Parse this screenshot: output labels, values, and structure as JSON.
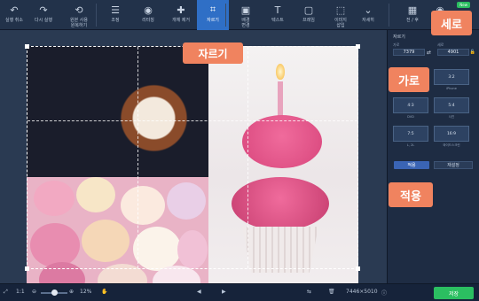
{
  "toolbar": {
    "tools": [
      {
        "id": "undo",
        "icon": "↶",
        "label": "실행 취소"
      },
      {
        "id": "redo",
        "icon": "↷",
        "label": "다시 실행"
      },
      {
        "id": "restore",
        "icon": "⟲",
        "label": "원본 사용\n원복하기"
      },
      {
        "id": "adjust",
        "icon": "☰",
        "label": "조정"
      },
      {
        "id": "retouch",
        "icon": "◉",
        "label": "리터칭"
      },
      {
        "id": "remove-object",
        "icon": "✚",
        "label": "개체 제거"
      },
      {
        "id": "crop",
        "icon": "⌗",
        "label": "자르기"
      },
      {
        "id": "background",
        "icon": "▣",
        "label": "배경\n변경"
      },
      {
        "id": "text",
        "icon": "T",
        "label": "텍스트"
      },
      {
        "id": "frame",
        "icon": "▢",
        "label": "프레임"
      },
      {
        "id": "insert-image",
        "icon": "⬚",
        "label": "이미지\n삽입"
      },
      {
        "id": "more",
        "icon": "⌄",
        "label": "자세히"
      }
    ],
    "right_label": "전 / 후",
    "new_badge": "New"
  },
  "panel": {
    "title": "자르기",
    "width_label": "가로",
    "height_label": "세로",
    "width_value": "7379",
    "height_value": "4901",
    "presets": [
      {
        "ratio": "",
        "caption": ""
      },
      {
        "ratio": "3:2",
        "caption": "iPhone"
      },
      {
        "ratio": "4:3",
        "caption": "DVD"
      },
      {
        "ratio": "5:4",
        "caption": "사진"
      },
      {
        "ratio": "7:5",
        "caption": "L, 2L"
      },
      {
        "ratio": "16:9",
        "caption": "와이드스크린"
      }
    ],
    "apply_label": "적용",
    "reset_label": "재설정"
  },
  "callouts": {
    "crop": "자르기",
    "height": "세로",
    "width": "가로",
    "apply": "적용"
  },
  "bottombar": {
    "ratio_label": "1:1",
    "zoom_percent": "12%",
    "dimensions": "7446×5010",
    "save_label": "저장"
  }
}
